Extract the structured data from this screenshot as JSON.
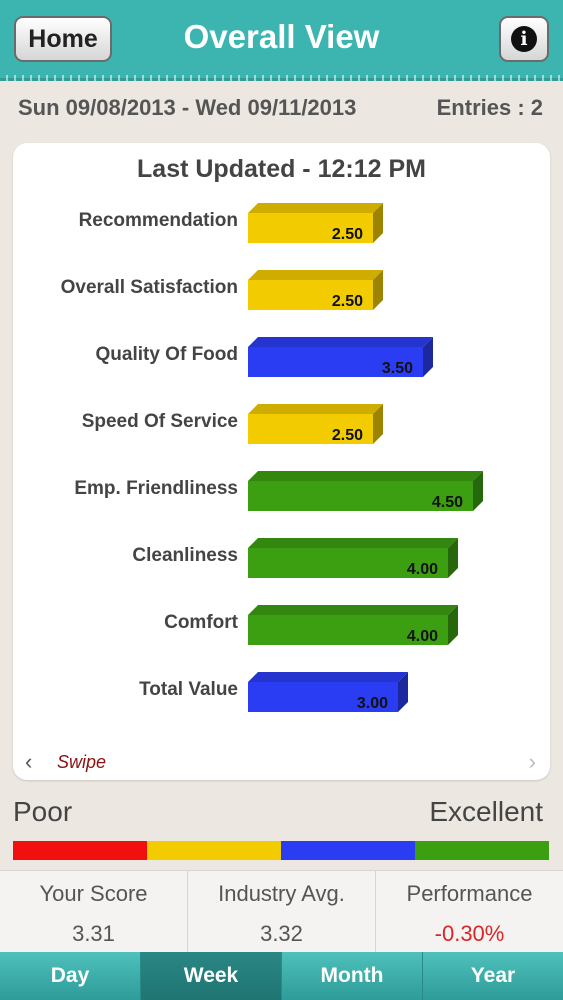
{
  "header": {
    "home_label": "Home",
    "title": "Overall View",
    "info_icon": "info-icon",
    "info_glyph": "i"
  },
  "summary": {
    "date_range": "Sun 09/08/2013 - Wed 09/11/2013",
    "entries": "Entries : 2"
  },
  "card": {
    "last_updated": "Last Updated - 12:12 PM",
    "swipe_label": "Swipe",
    "swipe_left_glyph": "‹",
    "swipe_right_glyph": "›"
  },
  "chart_data": {
    "type": "bar",
    "orientation": "horizontal",
    "categories": [
      "Recommendation",
      "Overall Satisfaction",
      "Quality Of Food",
      "Speed Of Service",
      "Emp. Friendliness",
      "Cleanliness",
      "Comfort",
      "Total Value"
    ],
    "values": [
      2.5,
      2.5,
      3.5,
      2.5,
      4.5,
      4.0,
      4.0,
      3.0
    ],
    "value_labels": [
      "2.50",
      "2.50",
      "3.50",
      "2.50",
      "4.50",
      "4.00",
      "4.00",
      "3.00"
    ],
    "bar_colors": [
      "yellow",
      "yellow",
      "blue",
      "yellow",
      "green",
      "green",
      "green",
      "blue"
    ],
    "xlim": [
      0,
      5
    ],
    "grid": false,
    "title": "",
    "xlabel": "",
    "ylabel": ""
  },
  "colors": {
    "yellow": "#f2cb00",
    "blue": "#2b3df2",
    "green": "#3c9e11",
    "red": "#f10f0f",
    "accent": "#3cb5b1"
  },
  "scale": {
    "poor_label": "Poor",
    "excellent_label": "Excellent",
    "segments": [
      "red",
      "yellow",
      "blue",
      "green"
    ]
  },
  "stats": {
    "your_score_label": "Your Score",
    "your_score_value": "3.31",
    "industry_label": "Industry Avg.",
    "industry_value": "3.32",
    "performance_label": "Performance",
    "performance_value": "-0.30%",
    "performance_color": "#d8262a"
  },
  "tabs": [
    {
      "label": "Day",
      "active": false
    },
    {
      "label": "Week",
      "active": true
    },
    {
      "label": "Month",
      "active": false
    },
    {
      "label": "Year",
      "active": false
    }
  ]
}
